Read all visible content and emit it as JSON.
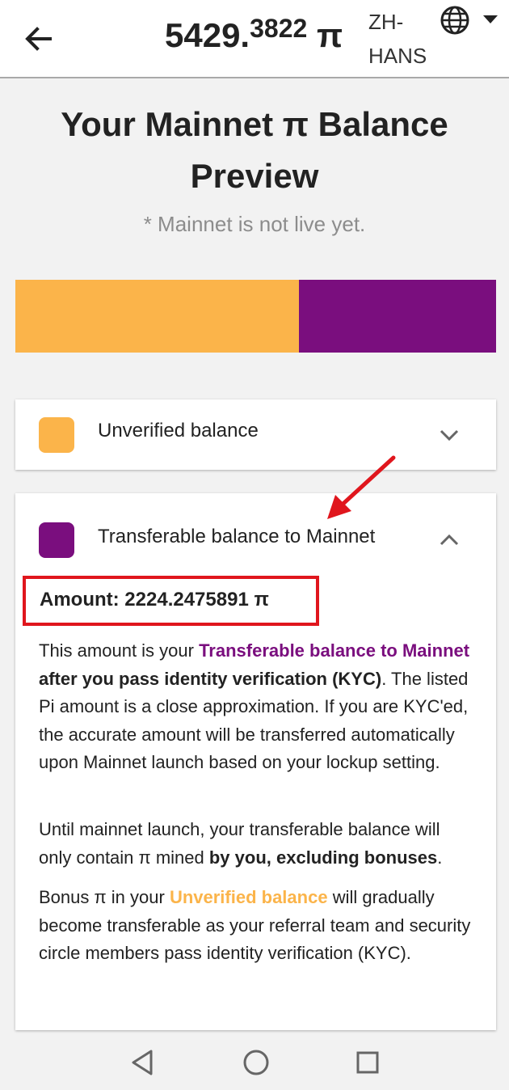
{
  "header": {
    "balance_int": "5429.",
    "balance_dec": "3822",
    "pi_symbol": "π",
    "language": "ZH-HANS",
    "icons": [
      "back-arrow-icon",
      "globe-icon",
      "caret-down-icon"
    ]
  },
  "title": "Your Mainnet π Balance Preview",
  "subtitle": "* Mainnet is not live yet.",
  "balance_bar": {
    "unverified_fraction": 0.59,
    "transferable_fraction": 0.41,
    "colors": {
      "unverified": "#fbb44a",
      "transferable": "#7a0e7e"
    }
  },
  "cards": {
    "unverified": {
      "label": "Unverified balance",
      "color": "#fbb44a",
      "expanded": false
    },
    "transferable": {
      "label": "Transferable balance to Mainnet",
      "color": "#7a0e7e",
      "expanded": true
    }
  },
  "amount": "Amount: 2224.2475891 π",
  "paragraphs": {
    "p1": {
      "a": "This amount is your ",
      "b": "Transferable balance to Mainnet",
      "c": " after you pass identity verification (KYC)",
      "d": ". The listed Pi amount is a close approximation. If you are KYC'ed, the accurate amount will be transferred automatically upon Mainnet launch based on your lockup setting."
    },
    "p2": {
      "a": "Until mainnet launch, your transferable balance will only contain π mined ",
      "b": "by you, excluding bonuses",
      "c": "."
    },
    "p3": {
      "a": "Bonus π in your ",
      "b": "Unverified balance",
      "c": " will gradually become transferable as your referral team and security circle members pass identity verification (KYC)."
    }
  },
  "accent": {
    "highlight_box": "#e0161d",
    "annotation_arrow": "#e0161d"
  },
  "navbar": {
    "icons": [
      "back-triangle-icon",
      "home-circle-icon",
      "recents-square-icon"
    ]
  }
}
